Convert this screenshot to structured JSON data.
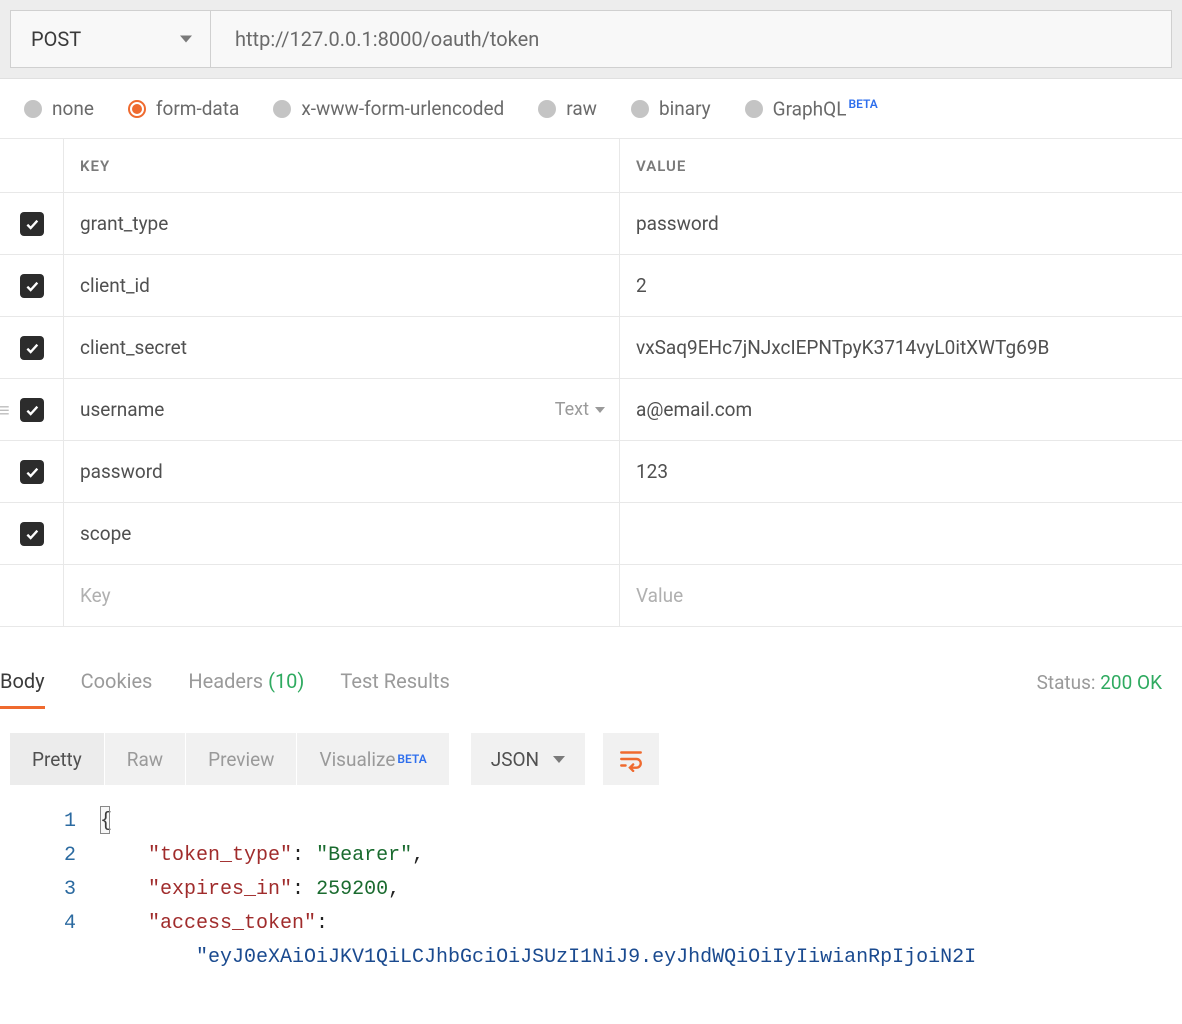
{
  "request": {
    "method": "POST",
    "url": "http://127.0.0.1:8000/oauth/token"
  },
  "body_types": {
    "none": "none",
    "form_data": "form-data",
    "urlencoded": "x-www-form-urlencoded",
    "raw": "raw",
    "binary": "binary",
    "graphql": "GraphQL",
    "beta": "BETA",
    "selected": "form-data"
  },
  "kv": {
    "header_key": "KEY",
    "header_value": "VALUE",
    "rows": [
      {
        "key": "grant_type",
        "value": "password",
        "type_label": ""
      },
      {
        "key": "client_id",
        "value": "2",
        "type_label": ""
      },
      {
        "key": "client_secret",
        "value": "vxSaq9EHc7jNJxcIEPNTpyK3714vyL0itXWTg69B",
        "type_label": ""
      },
      {
        "key": "username",
        "value": "a@email.com",
        "type_label": "Text"
      },
      {
        "key": "password",
        "value": "123",
        "type_label": ""
      },
      {
        "key": "scope",
        "value": "",
        "type_label": ""
      }
    ],
    "placeholder_key": "Key",
    "placeholder_value": "Value"
  },
  "response_tabs": {
    "body": "Body",
    "cookies": "Cookies",
    "headers": "Headers",
    "headers_count": "(10)",
    "tests": "Test Results"
  },
  "status": {
    "label": "Status:",
    "value": "200 OK"
  },
  "view_modes": {
    "pretty": "Pretty",
    "raw": "Raw",
    "preview": "Preview",
    "visualize": "Visualize",
    "beta": "BETA"
  },
  "format": {
    "label": "JSON"
  },
  "code": {
    "lines": [
      "1",
      "2",
      "3",
      "4"
    ],
    "l1_open": "{",
    "l2_key": "\"token_type\"",
    "l2_val": "\"Bearer\"",
    "l3_key": "\"expires_in\"",
    "l3_val": "259200",
    "l4_key": "\"access_token\"",
    "l5_val": "\"eyJ0eXAiOiJKV1QiLCJhbGciOiJSUzI1NiJ9.eyJhdWQiOiIyIiwianRpIjoiN2I"
  }
}
